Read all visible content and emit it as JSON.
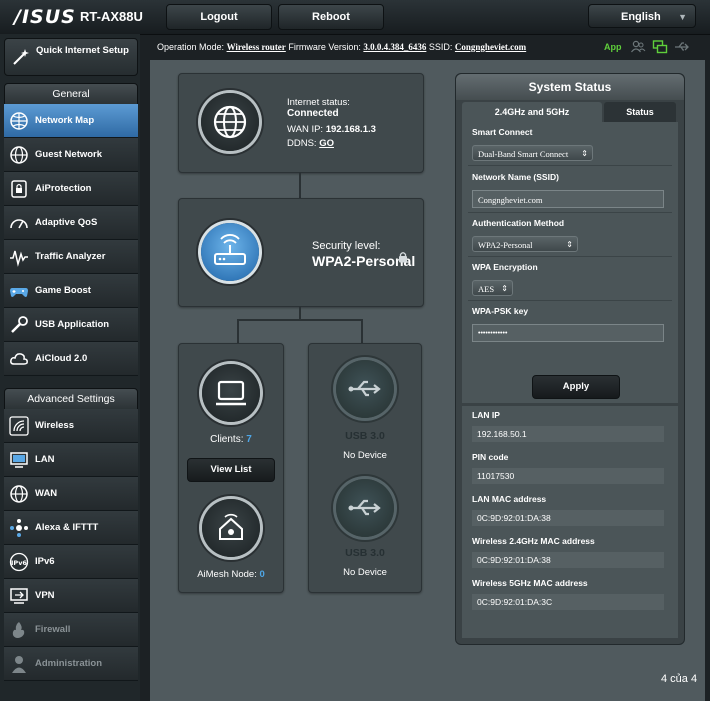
{
  "header": {
    "brand": "/ISUS",
    "model": "RT-AX88U",
    "logout_label": "Logout",
    "reboot_label": "Reboot",
    "language": "English"
  },
  "info_bar": {
    "operation_mode_label": "Operation Mode:",
    "operation_mode": "Wireless router",
    "firmware_label": "Firmware Version:",
    "firmware": "3.0.0.4.384_6436",
    "ssid_label": "SSID:",
    "ssid": "Congngheviet.com",
    "app_label": "App"
  },
  "sidebar": {
    "quick_setup": "Quick Internet Setup",
    "general_title": "General",
    "general_items": [
      {
        "label": "Network Map",
        "icon": "network-map-icon"
      },
      {
        "label": "Guest Network",
        "icon": "globe-icon"
      },
      {
        "label": "AiProtection",
        "icon": "lock-icon"
      },
      {
        "label": "Adaptive QoS",
        "icon": "gauge-icon"
      },
      {
        "label": "Traffic Analyzer",
        "icon": "waveform-icon"
      },
      {
        "label": "Game Boost",
        "icon": "gamepad-icon"
      },
      {
        "label": "USB Application",
        "icon": "usb-wrench-icon"
      },
      {
        "label": "AiCloud 2.0",
        "icon": "cloud-icon"
      }
    ],
    "advanced_title": "Advanced Settings",
    "advanced_items": [
      {
        "label": "Wireless",
        "icon": "wifi-icon"
      },
      {
        "label": "LAN",
        "icon": "monitor-icon"
      },
      {
        "label": "WAN",
        "icon": "globe-icon"
      },
      {
        "label": "Alexa & IFTTT",
        "icon": "link-dots-icon"
      },
      {
        "label": "IPv6",
        "icon": "ipv6-icon"
      },
      {
        "label": "VPN",
        "icon": "vpn-icon"
      },
      {
        "label": "Firewall",
        "icon": "firewall-icon"
      },
      {
        "label": "Administration",
        "icon": "admin-icon"
      }
    ]
  },
  "network_map": {
    "internet_status_label": "Internet status:",
    "internet_status": "Connected",
    "wan_ip_label": "WAN IP:",
    "wan_ip": "192.168.1.3",
    "ddns_label": "DDNS:",
    "ddns_link": "GO",
    "security_label": "Security level:",
    "security_value": "WPA2-Personal",
    "clients_label": "Clients:",
    "clients_count": "7",
    "view_list": "View List",
    "aimesh_label": "AiMesh Node:",
    "aimesh_count": "0",
    "usb1_label": "USB 3.0",
    "usb1_status": "No Device",
    "usb2_label": "USB 3.0",
    "usb2_status": "No Device"
  },
  "system_status": {
    "title": "System Status",
    "tab_bands": "2.4GHz and 5GHz",
    "tab_status": "Status",
    "smart_connect_label": "Smart Connect",
    "smart_connect_value": "Dual-Band Smart Connect",
    "ssid_label": "Network Name (SSID)",
    "ssid_value": "Congngheviet.com",
    "auth_label": "Authentication Method",
    "auth_value": "WPA2-Personal",
    "encryption_label": "WPA Encryption",
    "encryption_value": "AES",
    "psk_label": "WPA-PSK key",
    "psk_value": "••••••••••••",
    "apply_label": "Apply",
    "lan_ip_label": "LAN IP",
    "lan_ip": "192.168.50.1",
    "pin_label": "PIN code",
    "pin": "11017530",
    "lan_mac_label": "LAN MAC address",
    "lan_mac": "0C:9D:92:01:DA:38",
    "mac24_label": "Wireless 2.4GHz MAC address",
    "mac24": "0C:9D:92:01:DA:38",
    "mac5_label": "Wireless 5GHz MAC address",
    "mac5": "0C:9D:92:01:DA:3C"
  },
  "page_counter": "4 của 4",
  "colors": {
    "accent_blue": "#3f82c4",
    "app_green": "#5fcf3b",
    "panel_bg": "#505a5e"
  }
}
